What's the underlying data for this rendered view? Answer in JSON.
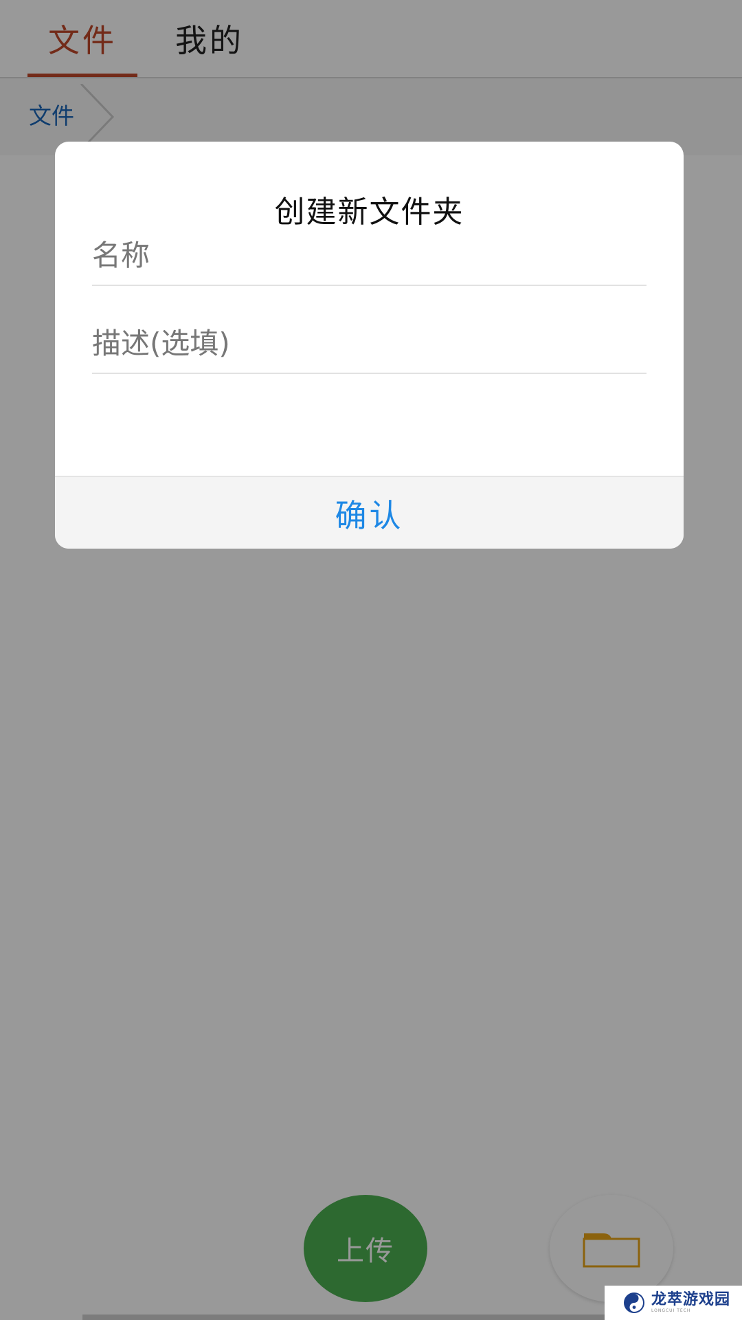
{
  "tabs": [
    {
      "label": "文件",
      "active": true
    },
    {
      "label": "我的",
      "active": false
    }
  ],
  "breadcrumb": {
    "items": [
      "文件"
    ]
  },
  "dialog": {
    "title": "创建新文件夹",
    "name_placeholder": "名称",
    "name_value": "",
    "desc_placeholder": "描述(选填)",
    "desc_value": "",
    "confirm_label": "确认"
  },
  "fab": {
    "upload_label": "上传",
    "folder_icon": "folder-icon"
  },
  "watermark": {
    "text": "龙萃游戏园",
    "subtext": "LONGCUI TECH"
  },
  "colors": {
    "tab_active": "#c0482a",
    "breadcrumb": "#1c66b8",
    "confirm": "#1e88e5",
    "upload_fab": "#4caf50",
    "folder_icon": "#e8a317"
  }
}
